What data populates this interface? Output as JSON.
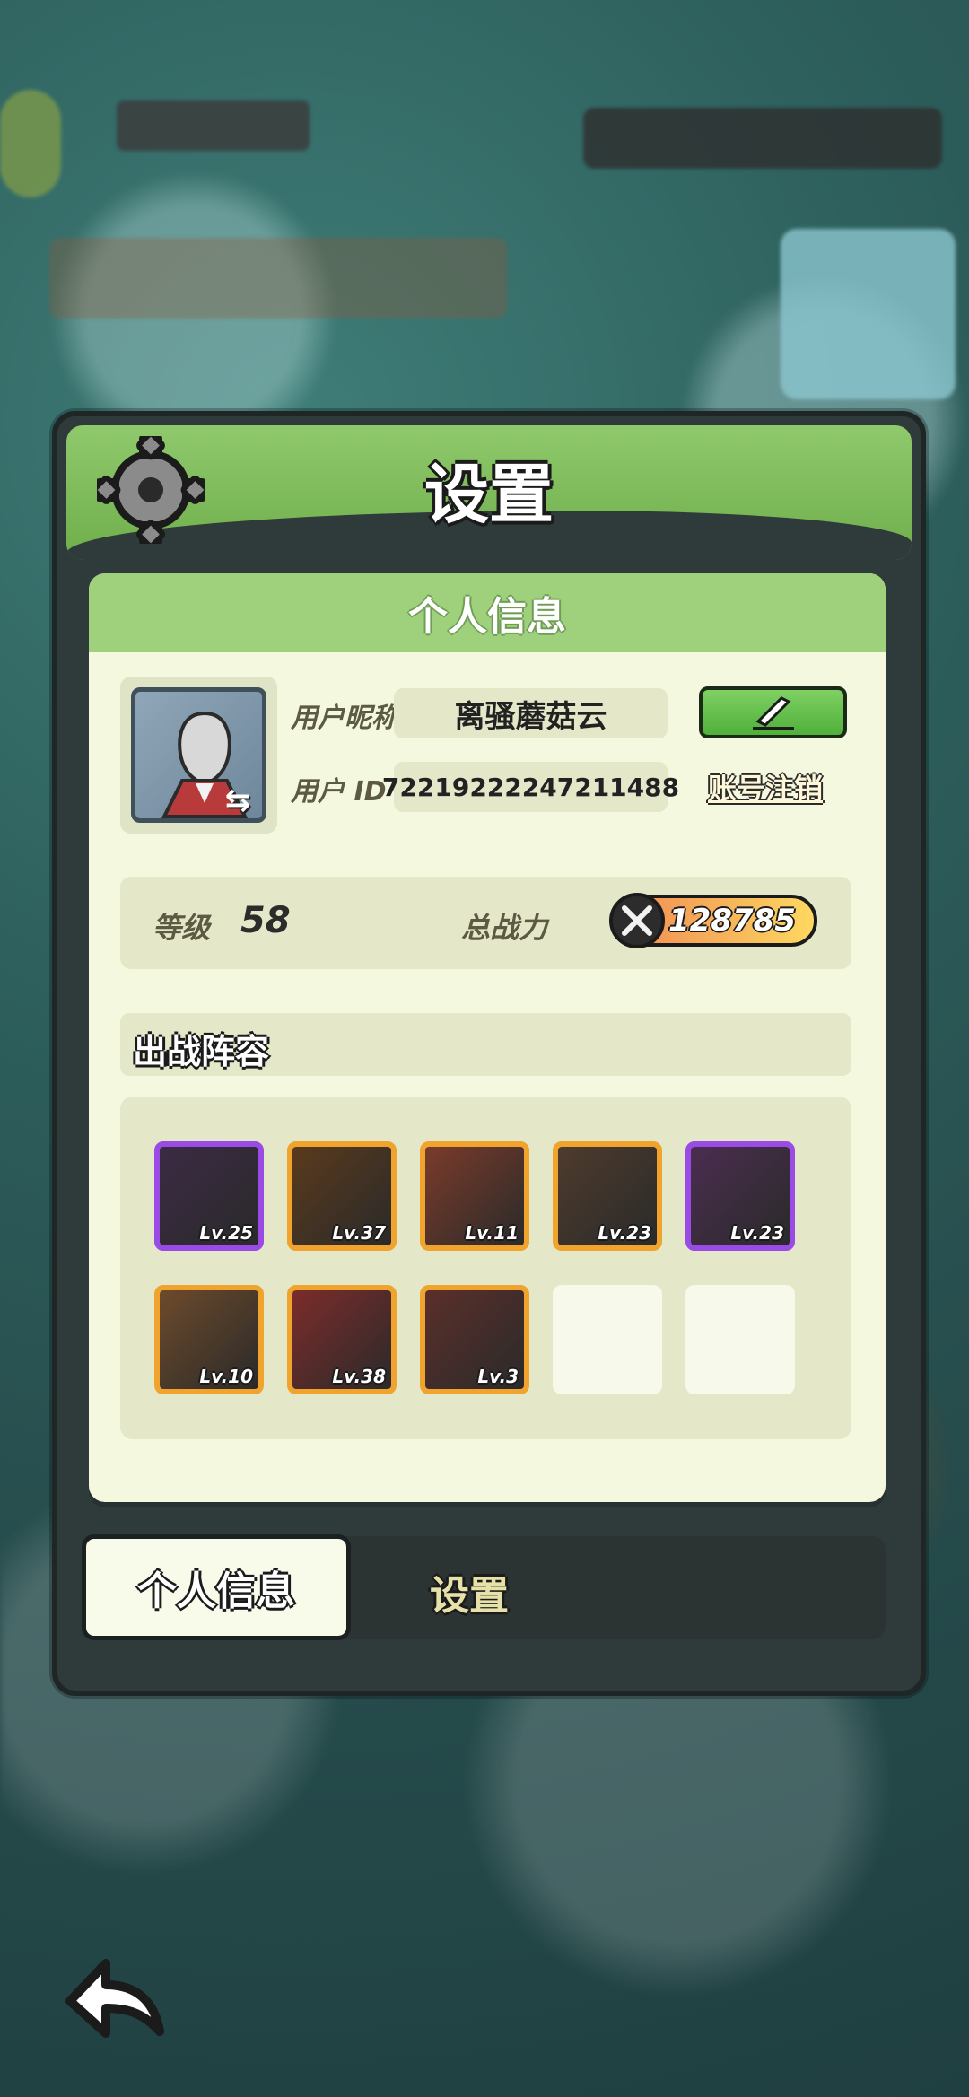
{
  "background": {
    "hud": {
      "has_avatar": true
    }
  },
  "panel": {
    "title": "设置",
    "card": {
      "title": "个人信息",
      "profile": {
        "nickname_label": "用户昵称",
        "nickname_value": "离骚蘑菇云",
        "user_id_label": "用户 ID",
        "user_id_value": "72219222247211488",
        "edit_button_icon": "pencil-icon",
        "account_cancel_label": "账号注销"
      },
      "stats": {
        "level_label": "等级",
        "level_value": "58",
        "power_label": "总战力",
        "power_value": "128785",
        "power_icon": "crossed-swords-icon"
      },
      "lineup": {
        "title": "出战阵容",
        "slots": [
          {
            "level": "Lv.25",
            "frame": "#9a4be6",
            "bg": "#3b2a44"
          },
          {
            "level": "Lv.37",
            "frame": "#f0a32d",
            "bg": "#5a3a1c"
          },
          {
            "level": "Lv.11",
            "frame": "#f0a32d",
            "bg": "#7a3b2a"
          },
          {
            "level": "Lv.23",
            "frame": "#f0a32d",
            "bg": "#4e3b2c"
          },
          {
            "level": "Lv.23",
            "frame": "#9a4be6",
            "bg": "#4b2d50"
          },
          {
            "level": "Lv.10",
            "frame": "#f0a32d",
            "bg": "#6d4a2b"
          },
          {
            "level": "Lv.38",
            "frame": "#f0a32d",
            "bg": "#7b2c2a"
          },
          {
            "level": "Lv.3",
            "frame": "#f0a32d",
            "bg": "#5b2f2a"
          },
          {
            "level": "",
            "frame": "",
            "bg": ""
          },
          {
            "level": "",
            "frame": "",
            "bg": ""
          }
        ]
      }
    },
    "tabs": {
      "active": "个人信息",
      "inactive": "设置"
    }
  },
  "footer": {
    "back_icon": "back-arrow-icon"
  }
}
